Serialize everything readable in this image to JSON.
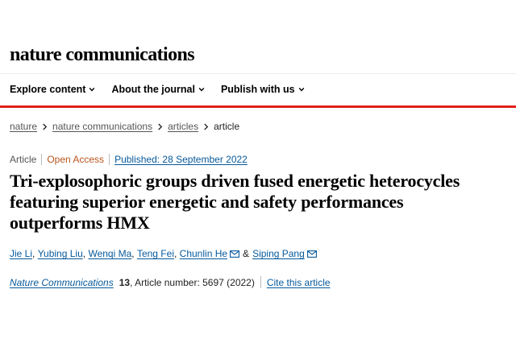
{
  "site": {
    "logo": "nature communications"
  },
  "nav": [
    {
      "label": "Explore content"
    },
    {
      "label": "About the journal"
    },
    {
      "label": "Publish with us"
    }
  ],
  "breadcrumb": [
    {
      "label": "nature"
    },
    {
      "label": "nature communications"
    },
    {
      "label": "articles"
    },
    {
      "label": "article"
    }
  ],
  "article": {
    "type": "Article",
    "access": "Open Access",
    "published": "Published: 28 September 2022",
    "title": "Tri-explosophoric groups driven fused energetic heterocycles featuring superior energetic and safety performances outperforms HMX",
    "authors": [
      {
        "name": "Jie Li"
      },
      {
        "name": "Yubing Liu"
      },
      {
        "name": "Wenqi Ma"
      },
      {
        "name": "Teng Fei"
      },
      {
        "name": "Chunlin He"
      },
      {
        "name": "Siping Pang"
      }
    ],
    "author_sep": ",",
    "author_amp": "&",
    "journal": "Nature Communications",
    "volume": "13",
    "article_number": ", Article number: 5697 (2022)",
    "cite_label": "Cite this article"
  },
  "colors": {
    "accent_red": "#e0201b",
    "link_blue": "#06599b",
    "open_access": "#b9531c"
  },
  "icons": {
    "nav_dropdown": "chevron-down-icon",
    "breadcrumb_sep": "chevron-right-icon",
    "corresponding": "mail-icon"
  }
}
